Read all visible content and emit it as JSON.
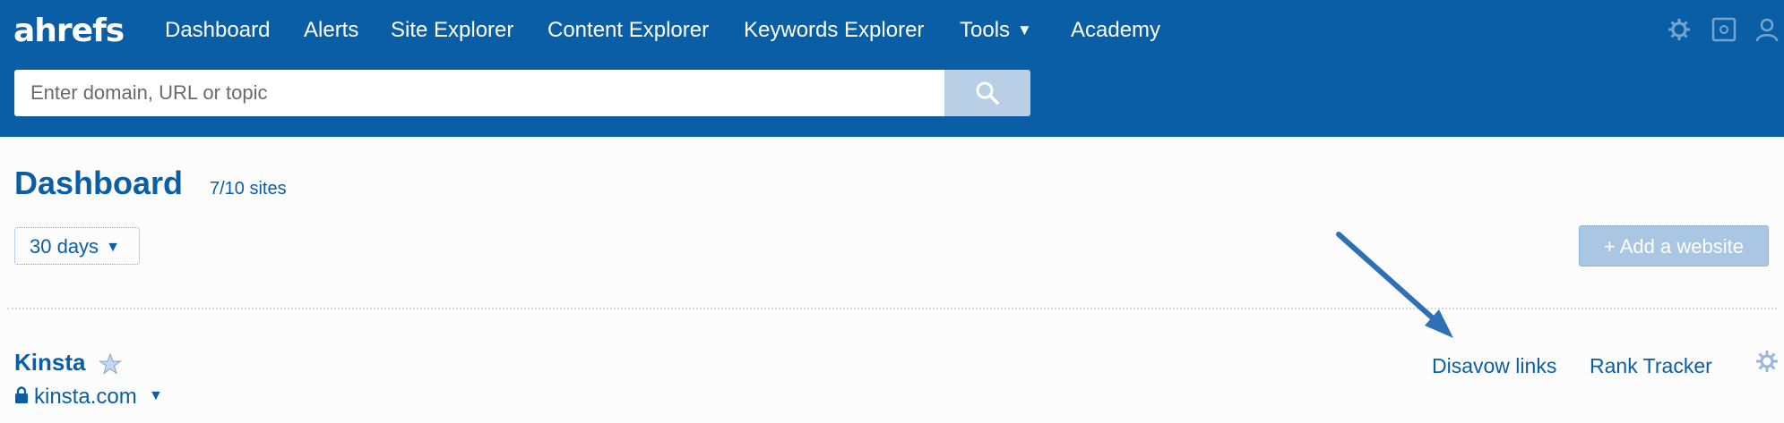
{
  "app": {
    "logo_text": "ahrefs"
  },
  "nav": {
    "items": [
      {
        "label": "Dashboard"
      },
      {
        "label": "Alerts"
      },
      {
        "label": "Site Explorer"
      },
      {
        "label": "Content Explorer"
      },
      {
        "label": "Keywords Explorer"
      },
      {
        "label": "Tools",
        "caret": "▼"
      },
      {
        "label": "Academy"
      }
    ],
    "icons": [
      "settings-icon",
      "help-icon",
      "user-icon"
    ]
  },
  "search": {
    "placeholder": "Enter domain, URL or topic",
    "value": "",
    "button_icon": "search-icon"
  },
  "dashboard": {
    "title": "Dashboard",
    "sites_count": "7/10 sites",
    "period": "30 days",
    "period_caret": "▼",
    "add_website_label": "+ Add a website"
  },
  "site": {
    "name": "Kinsta",
    "url": "kinsta.com",
    "url_caret": "▼",
    "links": {
      "disavow": "Disavow links",
      "rank_tracker": "Rank Tracker"
    }
  },
  "colors": {
    "brand_blue": "#0a5ea5",
    "link_blue": "#0a5ea5",
    "button_disabled": "#a9c6e2"
  }
}
